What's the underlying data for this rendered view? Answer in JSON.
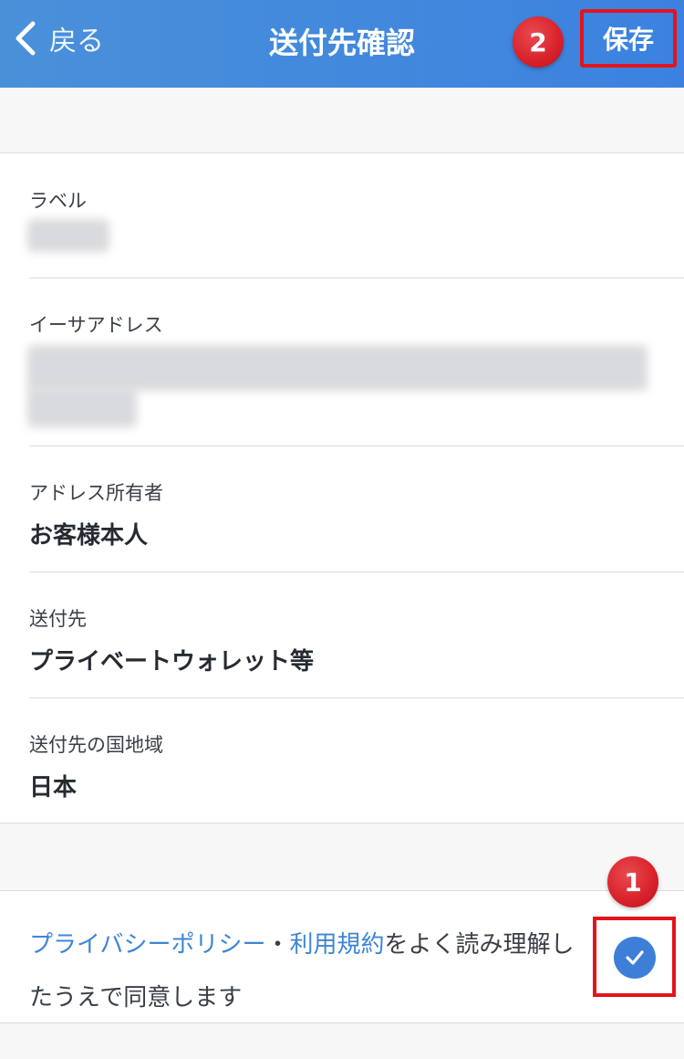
{
  "header": {
    "back_label": "戻る",
    "title": "送付先確認",
    "save_label": "保存",
    "color": "#3b82e0"
  },
  "annotations": {
    "step_1": "1",
    "step_2": "2",
    "color": "#e3141c"
  },
  "fields": [
    {
      "label": "ラベル",
      "value": ""
    },
    {
      "label": "イーサアドレス",
      "value": ""
    },
    {
      "label": "アドレス所有者",
      "value": "お客様本人"
    },
    {
      "label": "送付先",
      "value": "プライベートウォレット等"
    },
    {
      "label": "送付先の国地域",
      "value": "日本"
    }
  ],
  "consent": {
    "privacy_link": "プライバシーポリシー",
    "separator": "・",
    "terms_link": "利用規約",
    "text": "をよく読み理解したうえで同意します",
    "checked": true,
    "link_color": "#3d86d6",
    "check_color": "#3d7fd8"
  },
  "icons": {
    "back": "chevron-left-icon",
    "check": "checkmark-icon"
  }
}
